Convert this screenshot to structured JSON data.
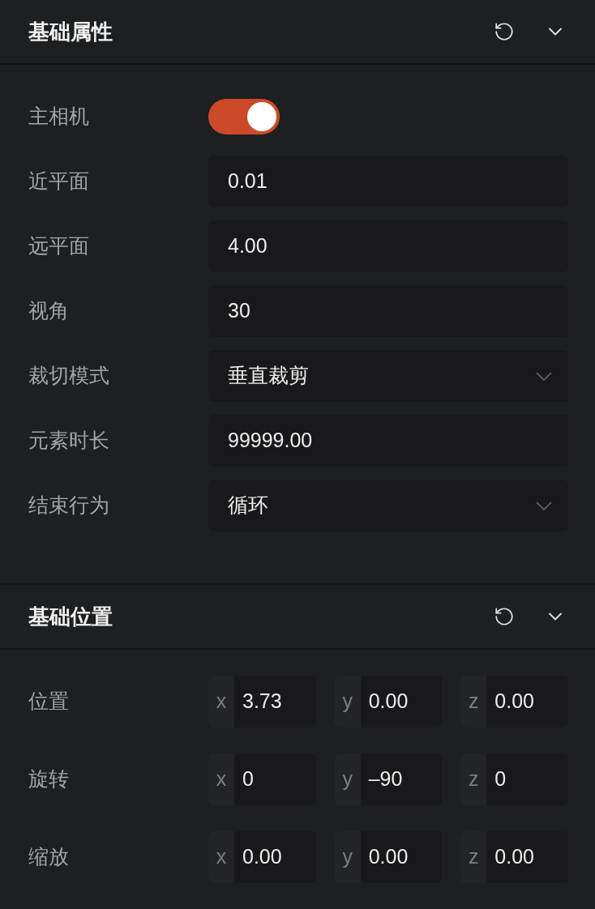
{
  "sections": [
    {
      "title": "基础属性",
      "expanded": true,
      "rows": [
        {
          "kind": "toggle",
          "label": "主相机",
          "on": true
        },
        {
          "kind": "text",
          "label": "近平面",
          "value": "0.01"
        },
        {
          "kind": "text",
          "label": "远平面",
          "value": "4.00"
        },
        {
          "kind": "text",
          "label": "视角",
          "value": "30"
        },
        {
          "kind": "select",
          "label": "裁切模式",
          "value": "垂直裁剪"
        },
        {
          "kind": "text",
          "label": "元素时长",
          "value": "99999.00"
        },
        {
          "kind": "select",
          "label": "结束行为",
          "value": "循环"
        }
      ]
    },
    {
      "title": "基础位置",
      "expanded": true,
      "rows": [
        {
          "kind": "vector",
          "label": "位置",
          "axes": [
            {
              "axis": "x",
              "value": "3.73"
            },
            {
              "axis": "y",
              "value": "0.00"
            },
            {
              "axis": "z",
              "value": "0.00"
            }
          ]
        },
        {
          "kind": "vector",
          "label": "旋转",
          "axes": [
            {
              "axis": "x",
              "value": "0"
            },
            {
              "axis": "y",
              "value": "–90"
            },
            {
              "axis": "z",
              "value": "0"
            }
          ]
        },
        {
          "kind": "vector",
          "label": "缩放",
          "axes": [
            {
              "axis": "x",
              "value": "0.00"
            },
            {
              "axis": "y",
              "value": "0.00"
            },
            {
              "axis": "z",
              "value": "0.00"
            }
          ]
        }
      ]
    }
  ]
}
